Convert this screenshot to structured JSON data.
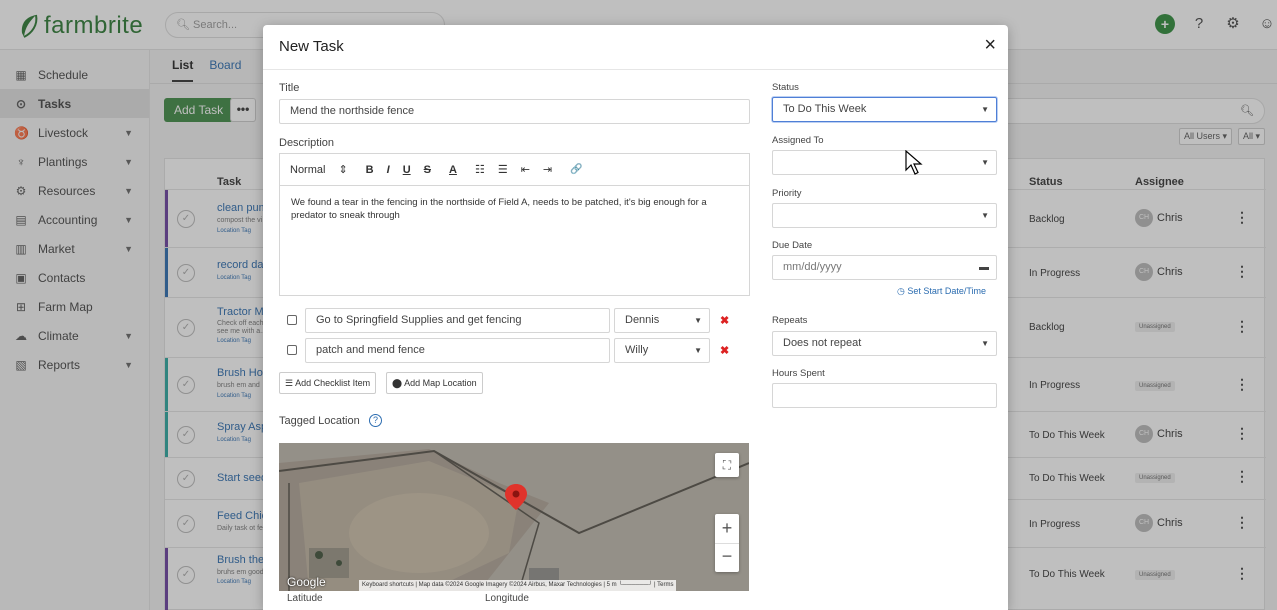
{
  "app": {
    "brand": "farmbrite",
    "search_placeholder": "Search...",
    "brand_color": "#2b7a32"
  },
  "sidebar": {
    "items": [
      {
        "label": "Schedule",
        "icon": "calendar-icon"
      },
      {
        "label": "Tasks",
        "icon": "check-circle-icon",
        "active": true
      },
      {
        "label": "Livestock",
        "icon": "cow-icon",
        "chevron": true
      },
      {
        "label": "Plantings",
        "icon": "sprout-icon",
        "chevron": true
      },
      {
        "label": "Resources",
        "icon": "tractor-icon",
        "chevron": true
      },
      {
        "label": "Accounting",
        "icon": "calculator-icon",
        "chevron": true
      },
      {
        "label": "Market",
        "icon": "store-icon",
        "chevron": true
      },
      {
        "label": "Contacts",
        "icon": "contact-card-icon"
      },
      {
        "label": "Farm Map",
        "icon": "map-icon"
      },
      {
        "label": "Climate",
        "icon": "cloud-icon",
        "chevron": true
      },
      {
        "label": "Reports",
        "icon": "report-icon",
        "chevron": true
      }
    ]
  },
  "main": {
    "tabs": [
      "List",
      "Board"
    ],
    "add_task_label": "Add Task",
    "more_label": "•••",
    "filter_users": "All Users ▾",
    "filter_all": "All ▾",
    "columns": {
      "task": "Task",
      "status": "Status",
      "assignee": "Assignee"
    },
    "rows": [
      {
        "title": "clean pum",
        "sub": "compost the vi",
        "tag": "Location Tag",
        "status": "Backlog",
        "assignee": "Chris",
        "initials": "CH",
        "bar": "#6b3fa0"
      },
      {
        "title": "record dail",
        "sub": "",
        "tag": "Location Tag",
        "status": "In Progress",
        "assignee": "Chris",
        "initials": "CH",
        "bar": "#2b6cb0"
      },
      {
        "title": "Tractor Ma",
        "sub": "Check off each",
        "sub2": "see me with a...",
        "tag": "Location Tag",
        "status": "Backlog",
        "assignee": "Unassigned",
        "bar": ""
      },
      {
        "title": "Brush Hor",
        "sub": "brush em and",
        "tag": "Location Tag",
        "status": "In Progress",
        "assignee": "Unassigned",
        "bar": "#2aa7a0"
      },
      {
        "title": "Spray Aspa",
        "sub": "",
        "tag": "Location Tag",
        "status": "To Do This Week",
        "assignee": "Chris",
        "initials": "CH",
        "bar": "#2aa7a0"
      },
      {
        "title": "Start seed",
        "sub": "",
        "tag": "",
        "status": "To Do This Week",
        "assignee": "Unassigned",
        "bar": ""
      },
      {
        "title": "Feed Chick",
        "sub": "Daily task ot fe",
        "tag": "",
        "status": "In Progress",
        "assignee": "Chris",
        "initials": "CH",
        "bar": ""
      },
      {
        "title": "Brush the",
        "sub": "bruhs em good",
        "tag": "Location Tag",
        "status": "To Do This Week",
        "assignee": "Unassigned",
        "bar": "#6b3fa0"
      }
    ]
  },
  "modal": {
    "title": "New Task",
    "close": "×",
    "title_label": "Title",
    "title_value": "Mend the northside fence",
    "description_label": "Description",
    "toolbar": {
      "format": "Normal",
      "format_arrow": "⇕",
      "bold": "B",
      "italic": "I",
      "underline": "U",
      "strike": "S",
      "color": "A",
      "ol": "☷",
      "ul": "☰",
      "indent_out": "⇤",
      "indent_in": "⇥",
      "link": "🔗"
    },
    "description_text": "We found a tear in the fencing in the northside of Field A, needs to be patched, it's big enough for a predator to sneak through",
    "checklist": [
      {
        "text": "Go to Springfield Supplies and get fencing",
        "assignee": "Dennis"
      },
      {
        "text": "patch and mend fence",
        "assignee": "Willy"
      }
    ],
    "add_checklist_label": "Add Checklist Item",
    "add_map_label": "Add Map Location",
    "tagged_location_label": "Tagged Location",
    "map": {
      "google": "Google",
      "attribution": "Keyboard shortcuts | Map data ©2024 Google Imagery ©2024 Airbus, Maxar Technologies | 5 m └──────┘ | Terms",
      "zoom_in": "+",
      "zoom_out": "−",
      "fullscreen": "⛶"
    },
    "latitude_label": "Latitude",
    "longitude_label": "Longitude",
    "status_label": "Status",
    "status_value": "To Do This Week",
    "assigned_label": "Assigned To",
    "assigned_value": "",
    "priority_label": "Priority",
    "priority_value": "",
    "due_label": "Due Date",
    "due_placeholder": "mm/dd/yyyy",
    "start_link": "Set Start Date/Time",
    "repeats_label": "Repeats",
    "repeats_value": "Does not repeat",
    "hours_label": "Hours Spent",
    "hours_value": ""
  }
}
